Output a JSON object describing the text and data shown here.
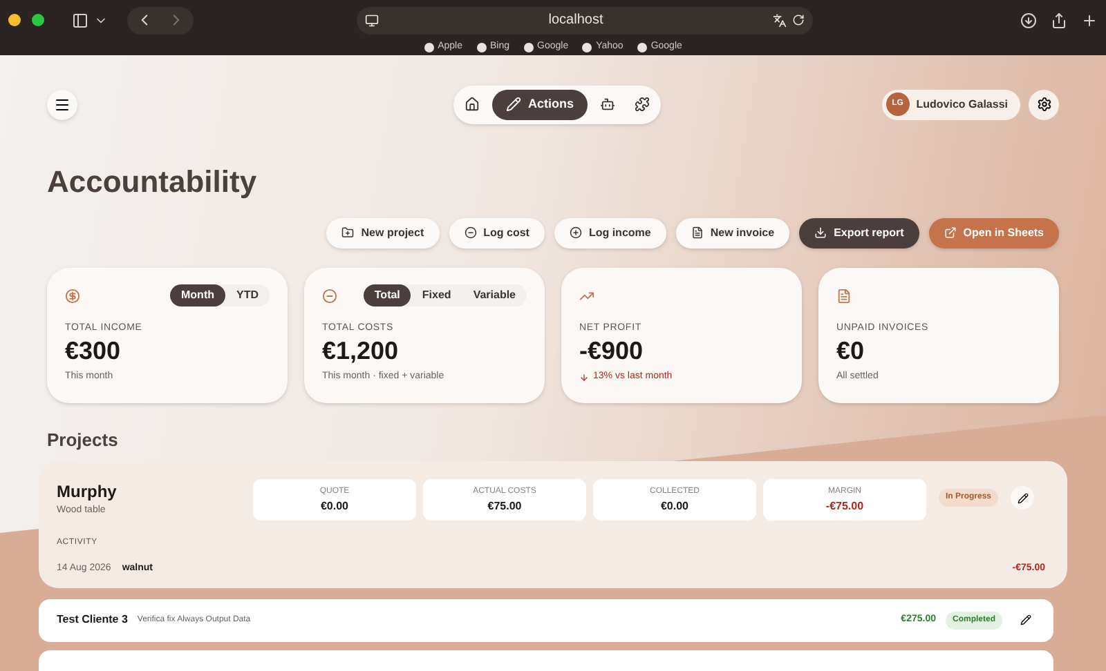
{
  "browser": {
    "address": "localhost",
    "bookmarks": [
      "Apple",
      "Bing",
      "Google",
      "Yahoo",
      "Google"
    ]
  },
  "nav": {
    "items": [
      {
        "kind": "home",
        "selected": false
      },
      {
        "kind": "actions",
        "label": "Actions",
        "selected": true
      },
      {
        "kind": "bot",
        "selected": false
      },
      {
        "kind": "puzzle",
        "selected": false
      }
    ]
  },
  "user": {
    "initials": "LG",
    "name": "Ludovico Galassi"
  },
  "title": "Accountability",
  "actions": [
    {
      "kind": "folder",
      "label": "New project"
    },
    {
      "kind": "minus",
      "label": "Log cost"
    },
    {
      "kind": "plus",
      "label": "Log income"
    },
    {
      "kind": "file",
      "label": "New invoice"
    },
    {
      "kind": "download",
      "label": "Export report"
    },
    {
      "kind": "external",
      "label": "Open in Sheets"
    }
  ],
  "stats": [
    {
      "kind": "coin",
      "toggles": [
        {
          "label": "Month",
          "selected": true
        },
        {
          "label": "YTD",
          "selected": false
        }
      ],
      "label": "TOTAL INCOME",
      "value": "€300",
      "note": "This month",
      "negative": false
    },
    {
      "kind": "minus",
      "toggles": [
        {
          "label": "Total",
          "selected": true
        },
        {
          "label": "Fixed",
          "selected": false
        },
        {
          "label": "Variable",
          "selected": false
        }
      ],
      "label": "TOTAL COSTS",
      "value": "€1,200",
      "note": "This month · fixed + variable",
      "negative": false
    },
    {
      "kind": "trend",
      "label": "NET PROFIT",
      "value": "-€900",
      "note": "13% vs last month",
      "negative": true
    },
    {
      "kind": "file",
      "label": "UNPAID INVOICES",
      "value": "€0",
      "note": "All settled",
      "negative": false
    }
  ],
  "projects_heading": "Projects",
  "project": {
    "name": "Murphy",
    "subtitle": "Wood table",
    "metrics": [
      {
        "label": "QUOTE",
        "value": "€0.00",
        "negative": false
      },
      {
        "label": "ACTUAL COSTS",
        "value": "€75.00",
        "negative": false
      },
      {
        "label": "COLLECTED",
        "value": "€0.00",
        "negative": false
      },
      {
        "label": "MARGIN",
        "value": "-€75.00",
        "negative": true
      }
    ],
    "status": {
      "label": "In Progress",
      "kind": "progress"
    },
    "activity_heading": "ACTIVITY",
    "activity": [
      {
        "date": "14 Aug 2026",
        "item": "walnut",
        "amount": "-€75.00",
        "negative": true
      }
    ]
  },
  "project_rows": [
    {
      "name": "Test Cliente 3",
      "description": "Verifica fix Always Output Data",
      "amount": "€275.00",
      "negative": false,
      "status": {
        "label": "Completed",
        "kind": "completed"
      }
    }
  ]
}
